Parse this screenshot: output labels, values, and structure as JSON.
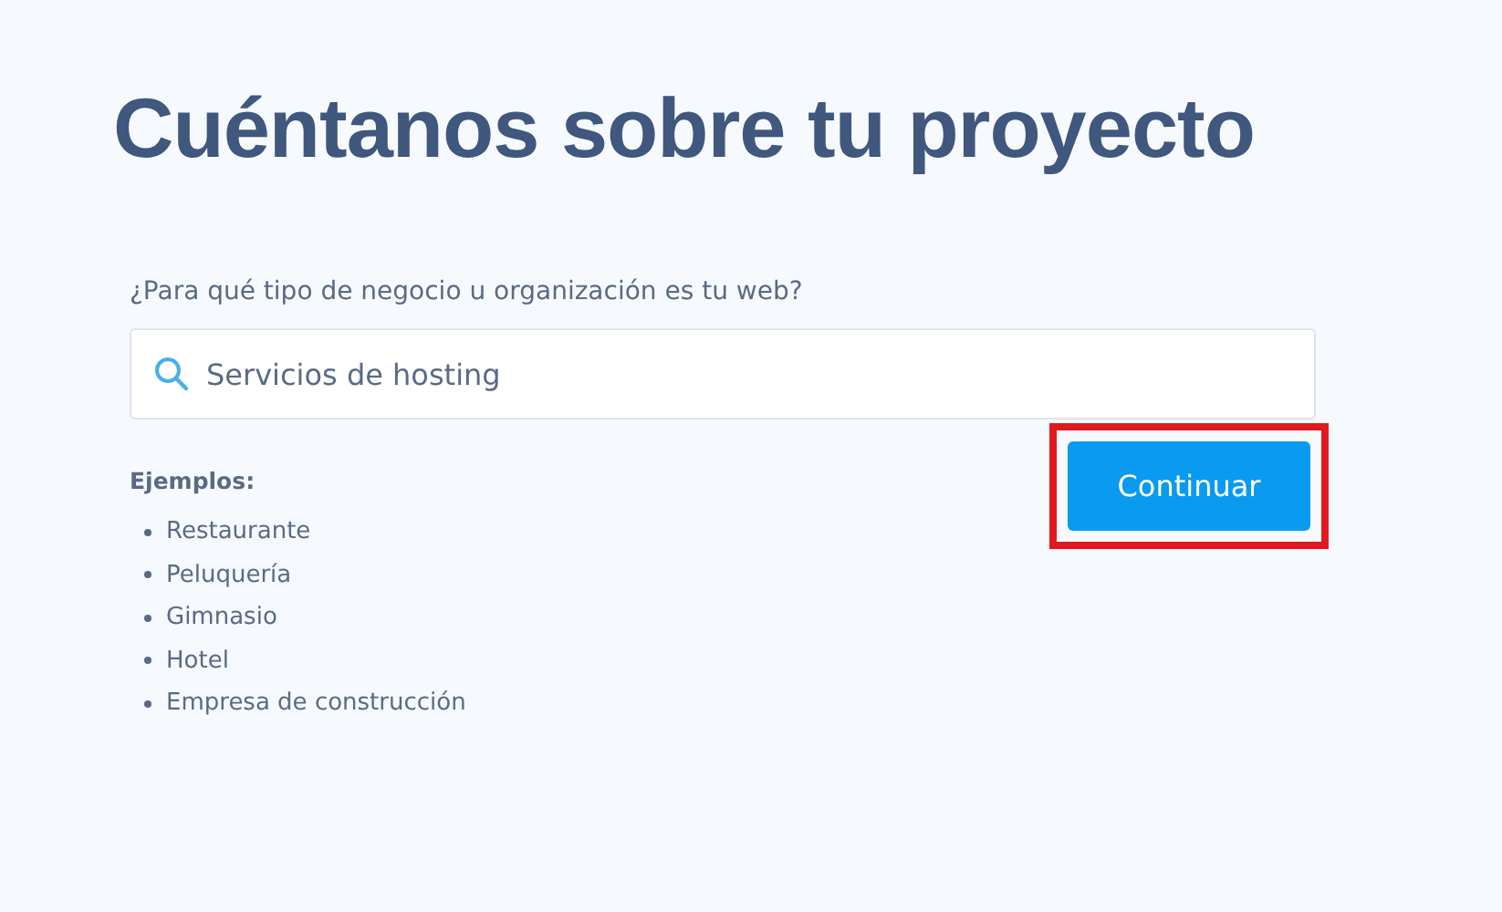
{
  "title": "Cuéntanos sobre tu proyecto",
  "question": "¿Para qué tipo de negocio u organización es tu web?",
  "search": {
    "value": "Servicios de hosting"
  },
  "examples": {
    "heading": "Ejemplos:",
    "items": [
      "Restaurante",
      "Peluquería",
      "Gimnasio",
      "Hotel",
      "Empresa de construcción"
    ]
  },
  "continue_button": {
    "label": "Continuar",
    "highlighted": true
  }
}
